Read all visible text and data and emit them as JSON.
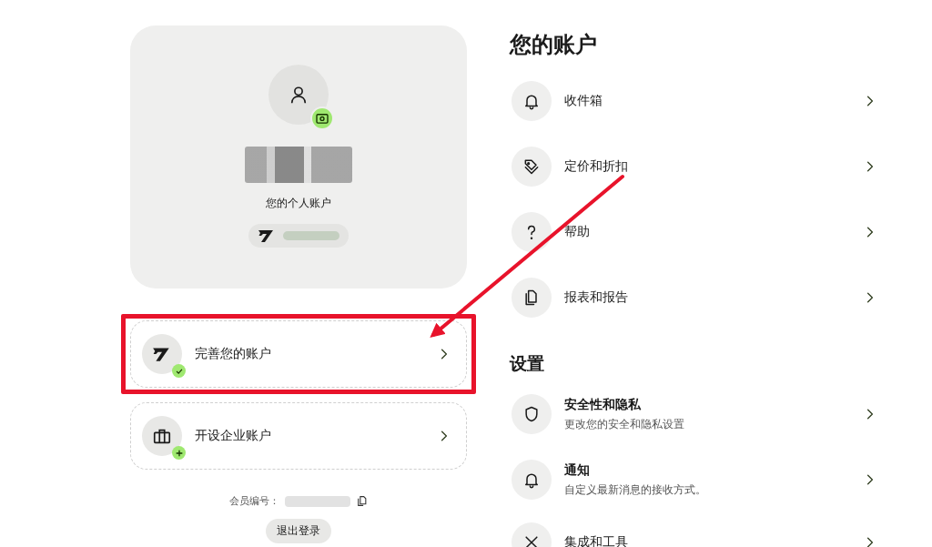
{
  "profile": {
    "account_type": "您的个人账户"
  },
  "account_actions": [
    {
      "kind": "verify",
      "label": "完善您的账户",
      "highlighted": true
    },
    {
      "kind": "business",
      "label": "开设企业账户",
      "highlighted": false
    }
  ],
  "member_number": {
    "label": "会员编号："
  },
  "logout_button": "退出登录",
  "account_section": {
    "title": "您的账户",
    "items": [
      {
        "label": "收件箱"
      },
      {
        "label": "定价和折扣"
      },
      {
        "label": "帮助"
      },
      {
        "label": "报表和报告"
      }
    ]
  },
  "settings_section": {
    "title": "设置",
    "items": [
      {
        "label": "安全性和隐私",
        "description": "更改您的安全和隐私设置"
      },
      {
        "label": "通知",
        "description": "自定义最新消息的接收方式。"
      },
      {
        "label": "集成和工具"
      }
    ]
  }
}
